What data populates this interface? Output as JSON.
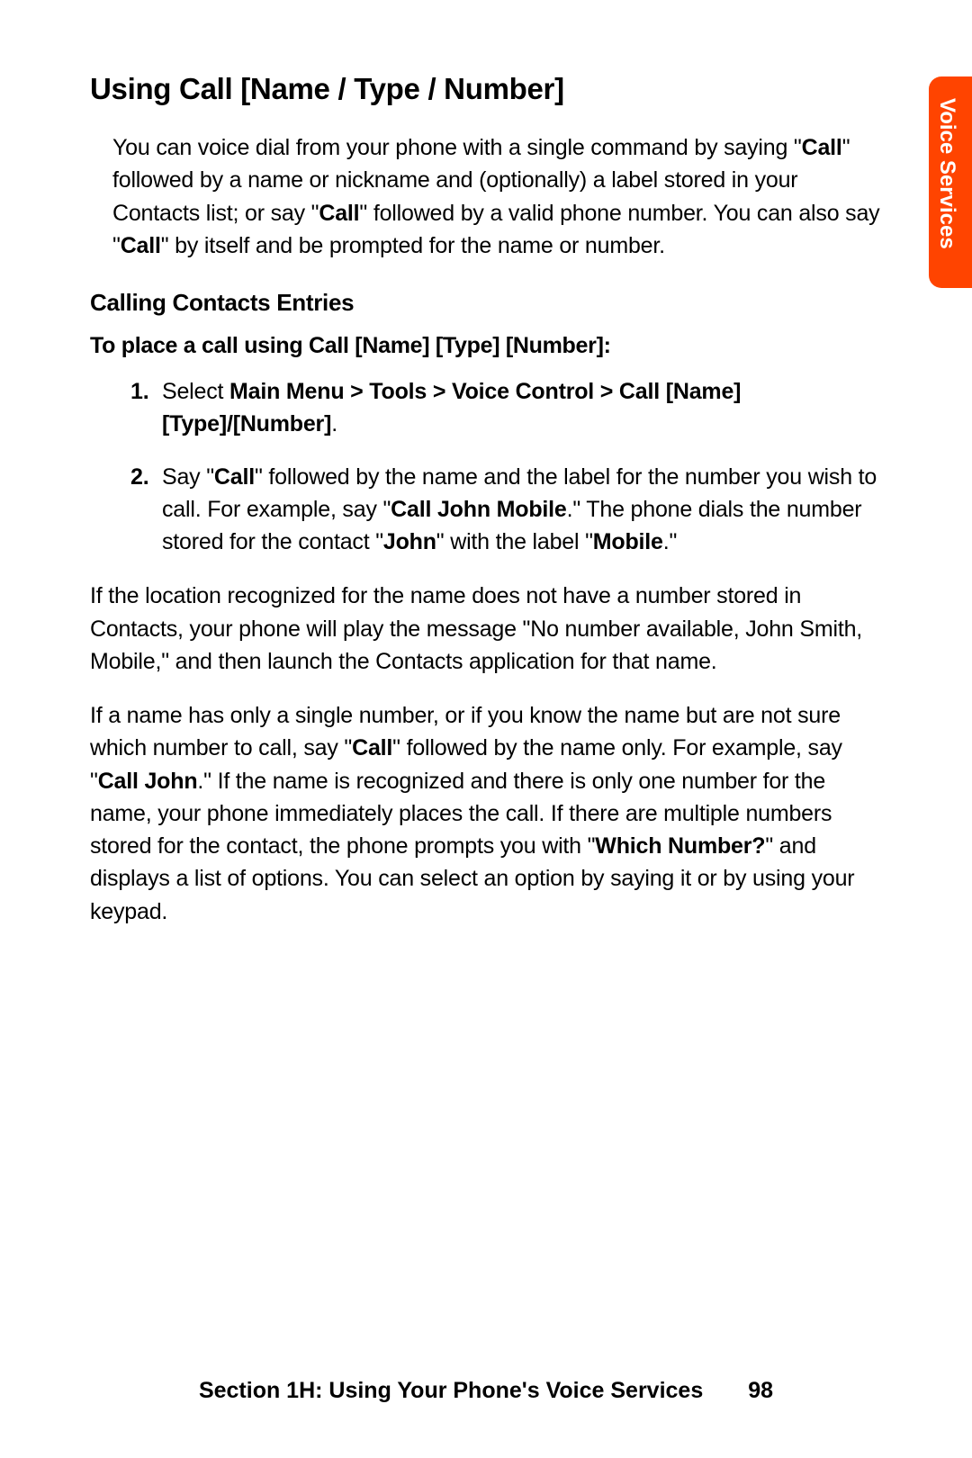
{
  "sideTab": "Voice Services",
  "title": "Using Call [Name / Type / Number]",
  "intro_parts": {
    "p1": "You can voice dial from your phone with a single command by saying \"",
    "b1": "Call",
    "p2": "\" followed by a name or nickname and (optionally) a label stored in your Contacts list; or say \"",
    "b2": "Call",
    "p3": "\" followed by a valid phone number. You can also say \"",
    "b3": "Call",
    "p4": "\" by itself and be prompted for the name or number."
  },
  "subheading": "Calling Contacts Entries",
  "instruction": "To place a call using Call [Name] [Type] [Number]:",
  "steps": [
    {
      "num": "1.",
      "pre": "Select ",
      "bold": "Main Menu > Tools > Voice Control > Call [Name] [Type]/[Number]",
      "post": "."
    },
    {
      "num": "2.",
      "p1": "Say \"",
      "b1": "Call",
      "p2": "\" followed by the name and the label for the number you wish to call. For example, say \"",
      "b2": "Call John Mobile",
      "p3": ".\" The phone dials the number stored for the contact \"",
      "b3": "John",
      "p4": "\" with the label \"",
      "b4": "Mobile",
      "p5": ".\""
    }
  ],
  "para1": "If the location recognized for the name does not have a number stored in Contacts, your phone will play the message \"No number available, John Smith, Mobile,\" and then launch the Contacts application for that name.",
  "para2": {
    "p1": "If a name has only a single number, or if you know the name but are not sure which number to call, say \"",
    "b1": "Call",
    "p2": "\" followed by the name only. For example, say \"",
    "b2": "Call John",
    "p3": ".\" If the name is recognized and there is only one number for the name, your phone immediately places the call. If there are multiple numbers stored for the contact, the phone prompts you with \"",
    "b3": "Which Number?",
    "p4": "\" and displays a list of options. You can select an option by saying it or by using your keypad."
  },
  "footer": {
    "section": "Section 1H: Using Your Phone's Voice Services",
    "page": "98"
  }
}
